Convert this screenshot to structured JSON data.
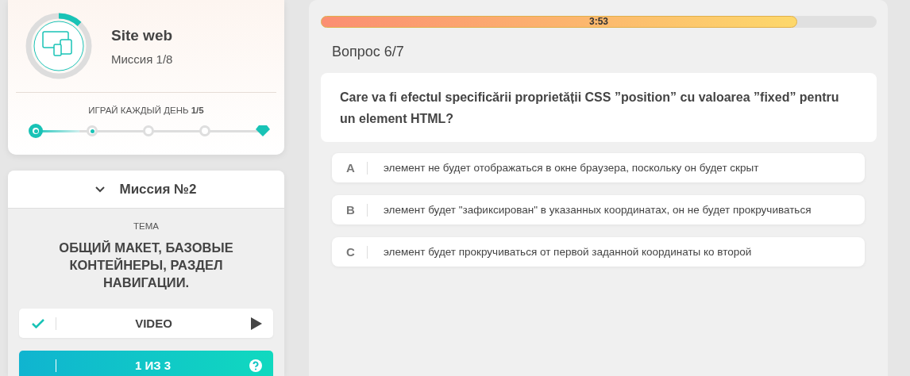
{
  "mission_card": {
    "logo": {
      "level": 0.12
    },
    "title": "Site web",
    "subtitle": "Миссия 1/8",
    "daily": {
      "label": "ИГРАЙ КАЖДЫЙ ДЕНЬ **1/5**",
      "level": 0.2,
      "steps": [
        {
          "kind": "done"
        },
        {
          "kind": "current"
        },
        {
          "kind": "todo"
        },
        {
          "kind": "todo"
        },
        {
          "kind": "diamond"
        }
      ]
    }
  },
  "mission_panel": {
    "title": "Миссия №2",
    "expanded": true,
    "topic_label": "ТЕМА",
    "topic": "ОБЩИЙ МАКЕТ, БАЗОВЫЕ КОНТЕЙНЕРЫ, РАЗДЕЛ НАВИГАЦИИ.",
    "steps": [
      {
        "kind": "video",
        "label": "VIDEO",
        "checked": true,
        "selected": false
      },
      {
        "kind": "quiz",
        "label": "1 ИЗ 3",
        "checked": false,
        "selected": true
      }
    ]
  },
  "quiz": {
    "timer": {
      "text": "3:53",
      "level": 0.857
    },
    "counter": "Вопрос 6/7",
    "question": "Care va fi efectul specificării proprietății CSS ”position” cu valoarea ”fixed” pentru un element HTML?",
    "answers": [
      {
        "letter": "A",
        "text": "элемент не будет отображаться в окне браузера, поскольку он будет скрыт",
        "selected": false
      },
      {
        "letter": "B",
        "text": "элемент будет \"зафиксирован\" в указанных координатах, он не будет прокручиваться",
        "selected": false
      },
      {
        "letter": "C",
        "text": "элемент будет прокручиваться от первой заданной координаты ко второй",
        "selected": false
      }
    ]
  }
}
